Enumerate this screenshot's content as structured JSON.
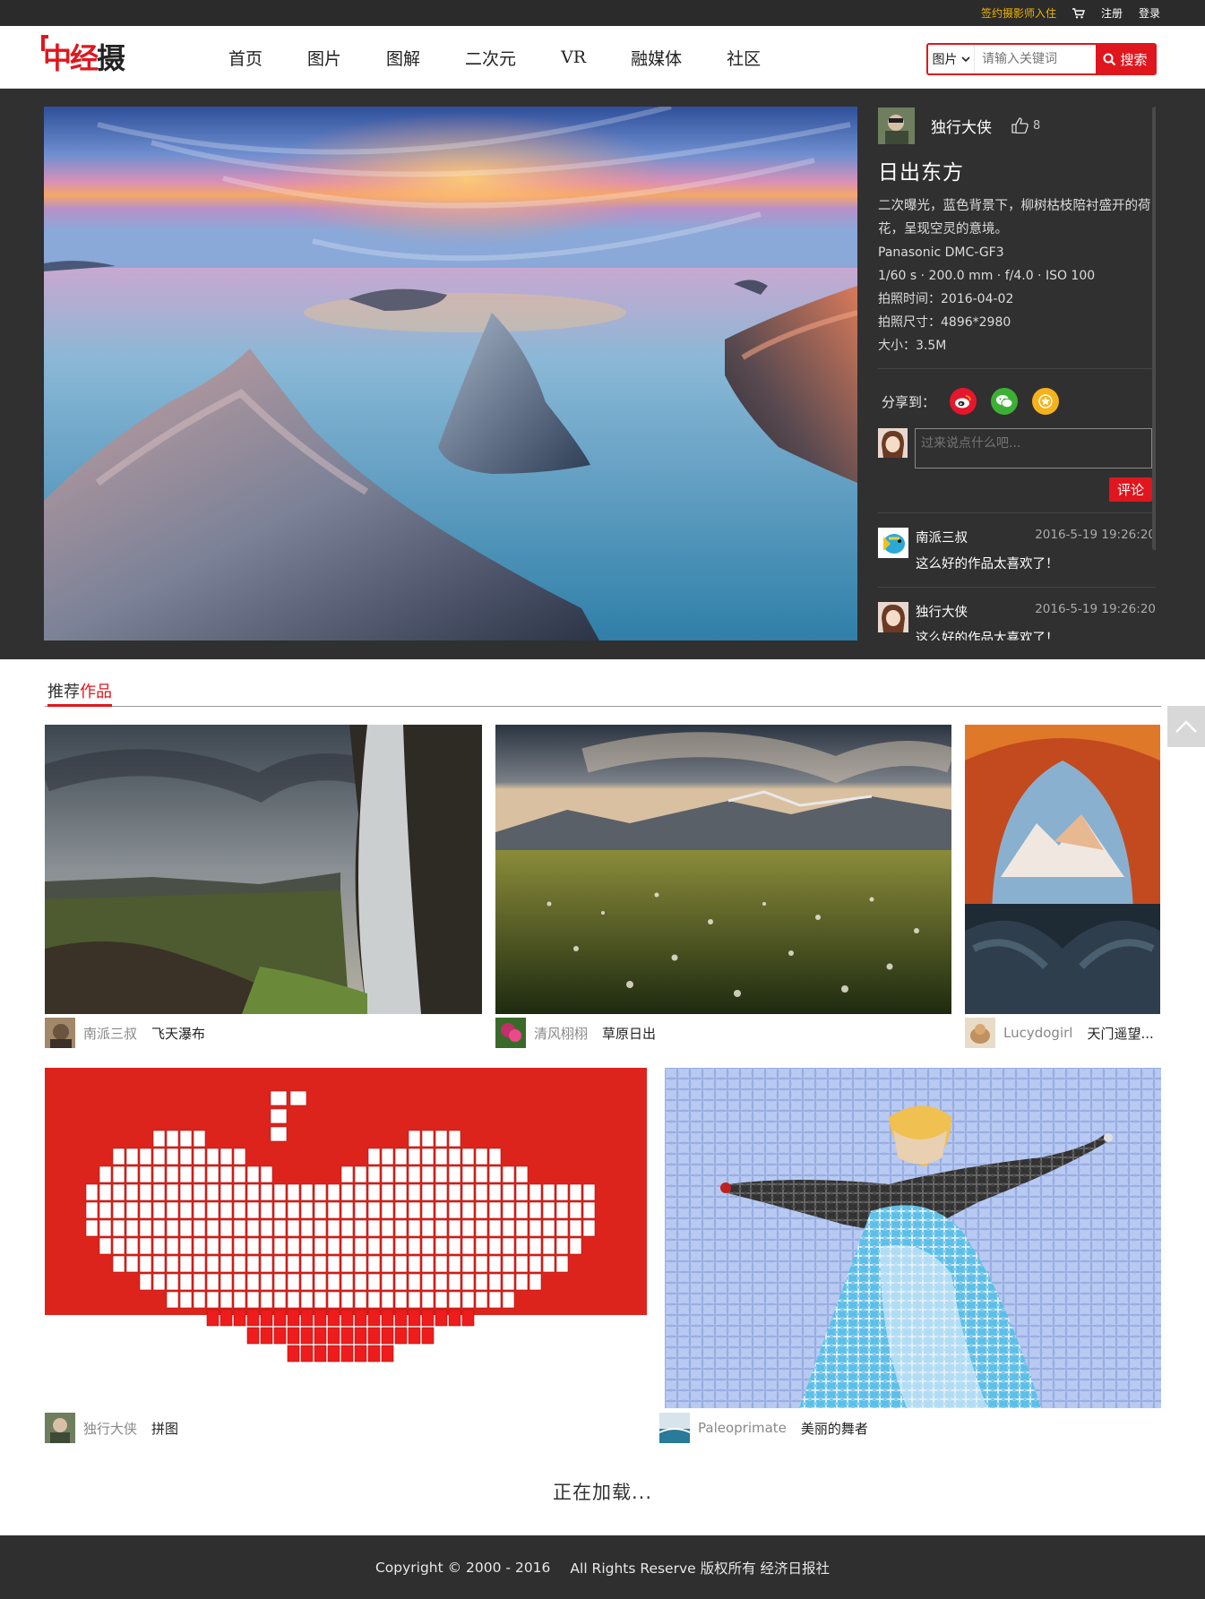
{
  "topbar": {
    "sign_photographer": "签约摄影师入住",
    "register": "注册",
    "login": "登录"
  },
  "logo": {
    "red": "中经",
    "dark": "摄"
  },
  "nav": [
    "首页",
    "图片",
    "图解",
    "二次元",
    "VR",
    "融媒体",
    "社区"
  ],
  "search": {
    "category": "图片",
    "placeholder": "请输入关键词",
    "button": "搜索"
  },
  "feature": {
    "author": "独行大侠",
    "likes": "8",
    "title": "日出东方",
    "description": "二次曝光，蓝色背景下，柳树枯枝陪衬盛开的荷花，呈现空灵的意境。",
    "camera": "Panasonic  DMC-GF3",
    "exposure": "1/60 s  ·  200.0 mm  ·  f/4.0  ·  ISO 100",
    "date": "拍照时间：2016-04-02",
    "dimensions": "拍照尺寸：4896*2980",
    "size": "大小：3.5M",
    "share_label": "分享到：",
    "comment_placeholder": "过来说点什么吧...",
    "comment_button": "评论",
    "comments": [
      {
        "user": "南派三叔",
        "time": "2016-5-19 19:26:20",
        "text": "这么好的作品太喜欢了！"
      },
      {
        "user": "独行大侠",
        "time": "2016-5-19 19:26:20",
        "text": "这么好的作品太喜欢了！"
      }
    ]
  },
  "recommend": {
    "title_prefix": "推荐",
    "title_accent": "作品",
    "items": [
      {
        "user": "南派三叔",
        "name": "飞天瀑布"
      },
      {
        "user": "清风栩栩",
        "name": "草原日出"
      },
      {
        "user": "Lucydogirl",
        "name": "天门遥望..."
      },
      {
        "user": "独行大侠",
        "name": "拼图"
      },
      {
        "user": "Paleoprimate",
        "name": "美丽的舞者"
      }
    ]
  },
  "loading": "正在加载...",
  "footer": {
    "copyright": "Copyright © 2000 - 2016",
    "rights": "All Rights Reserve  版权所有 经济日报社"
  },
  "colors": {
    "accent": "#e0161e",
    "dark_bg": "#303030",
    "gold": "#f0b400"
  },
  "icons": [
    "cart-icon",
    "thumb-up-icon",
    "weibo-icon",
    "wechat-icon",
    "favorite-star-icon",
    "search-icon",
    "chevron-down-icon",
    "back-to-top-icon"
  ]
}
